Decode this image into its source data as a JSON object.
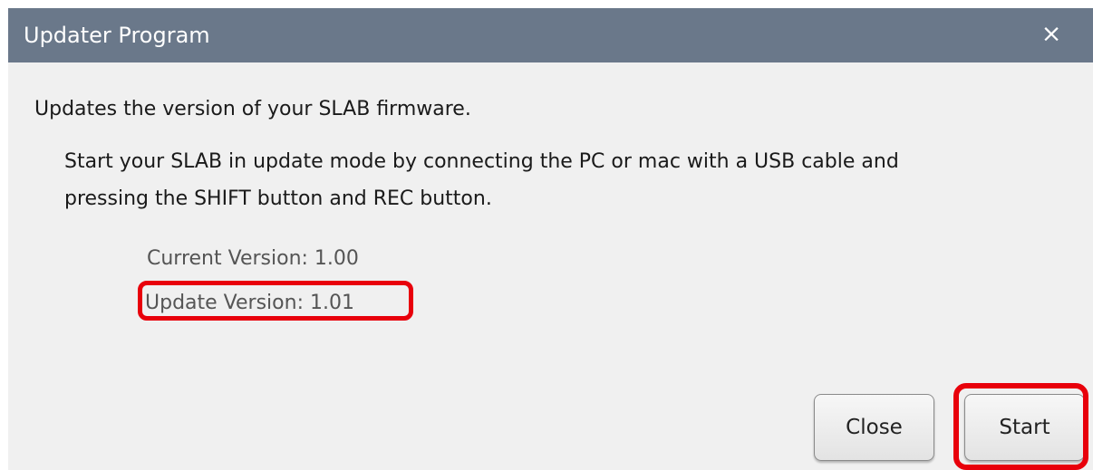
{
  "window": {
    "title": "Updater Program",
    "close_icon": "×"
  },
  "body": {
    "description": "Updates the version of your SLAB firmware.",
    "instruction_line1": "Start your SLAB in update mode by connecting the PC or mac with a USB cable and",
    "instruction_line2": "pressing the SHIFT button and REC button.",
    "current_version": "Current Version: 1.00",
    "update_version": "Update Version:  1.01"
  },
  "buttons": {
    "close_label": "Close",
    "start_label": "Start"
  },
  "colors": {
    "titlebar": "#6a788a",
    "dialog_background": "#f0f0f0",
    "highlight": "#e8000b"
  }
}
